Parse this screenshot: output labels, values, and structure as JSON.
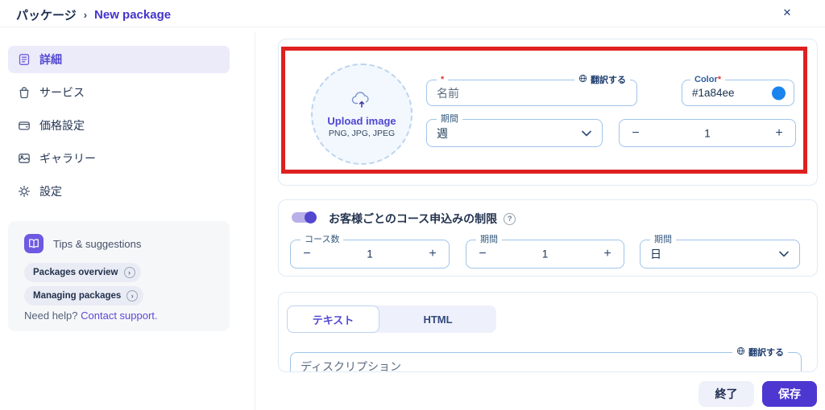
{
  "header": {
    "breadcrumb_root": "パッケージ",
    "breadcrumb_sep": "›",
    "breadcrumb_current": "New package",
    "close_icon": "✕"
  },
  "sidebar": {
    "items": [
      {
        "label": "詳細",
        "icon": "document-icon",
        "active": true
      },
      {
        "label": "サービス",
        "icon": "bag-icon",
        "active": false
      },
      {
        "label": "価格設定",
        "icon": "wallet-icon",
        "active": false
      },
      {
        "label": "ギャラリー",
        "icon": "gallery-icon",
        "active": false
      },
      {
        "label": "設定",
        "icon": "gear-icon",
        "active": false
      }
    ],
    "tips": {
      "title": "Tips & suggestions",
      "links": [
        {
          "label": "Packages overview",
          "chevron": "›"
        },
        {
          "label": "Managing packages",
          "chevron": "›"
        }
      ],
      "help_prefix": "Need help?",
      "help_link": "Contact support."
    }
  },
  "form": {
    "upload": {
      "title": "Upload image",
      "formats": "PNG, JPG, JPEG"
    },
    "name_field": {
      "required_mark": "*",
      "placeholder": "名前",
      "translate_label": "翻訳する"
    },
    "color_field": {
      "label": "Color",
      "required_mark": "*",
      "value": "#1a84ee",
      "swatch_color": "#1a84ee"
    },
    "duration_select": {
      "label": "期間",
      "value": "週"
    },
    "duration_stepper": {
      "minus": "−",
      "value": "1",
      "plus": "+"
    },
    "restriction": {
      "toggle_on": true,
      "label": "お客様ごとのコース申込みの制限",
      "help_icon": "?",
      "course_stepper": {
        "label": "コース数",
        "minus": "−",
        "value": "1",
        "plus": "+"
      },
      "period_stepper": {
        "label": "期間",
        "minus": "−",
        "value": "1",
        "plus": "+"
      },
      "period_select": {
        "label": "期間",
        "value": "日"
      }
    },
    "description": {
      "tabs": [
        {
          "label": "テキスト",
          "active": true
        },
        {
          "label": "HTML",
          "active": false
        }
      ],
      "translate_label": "翻訳する",
      "placeholder": "ディスクリプション"
    }
  },
  "footer": {
    "close_label": "終了",
    "save_label": "保存"
  },
  "colors": {
    "accent": "#4c38d0",
    "swatch": "#1a84ee",
    "annotation": "#de2020",
    "active_nav_bg": "#ecebfa"
  }
}
